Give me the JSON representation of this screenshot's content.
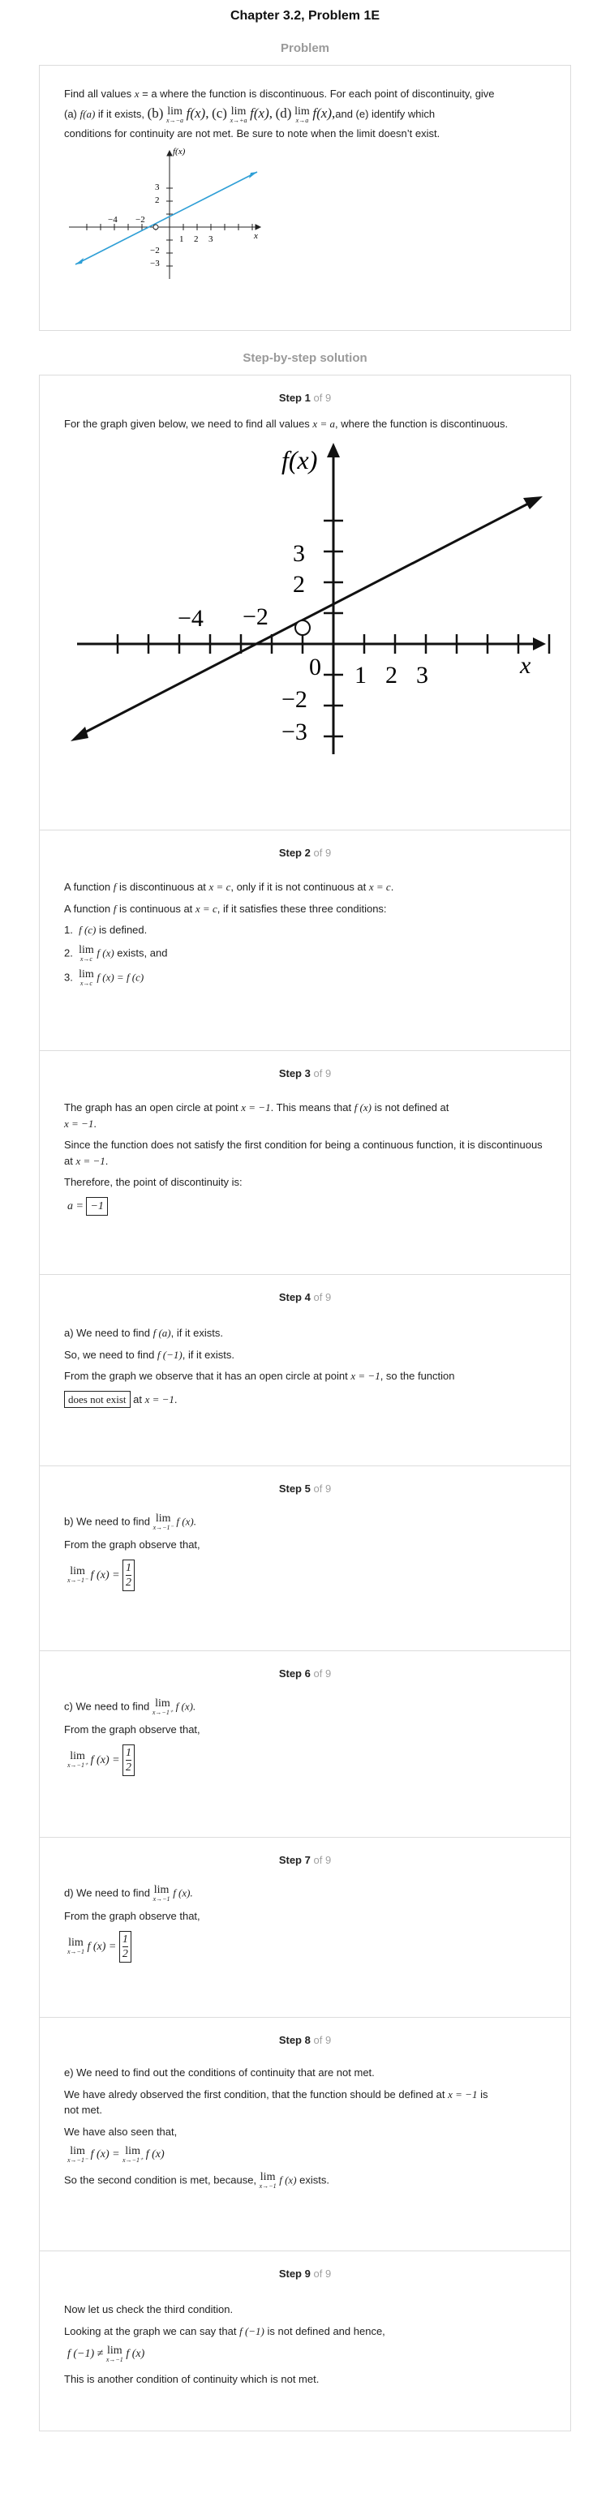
{
  "header": {
    "chapter_title": "Chapter 3.2, Problem 1E"
  },
  "problem": {
    "heading": "Problem",
    "text_a": "Find all values ",
    "var_x": "x",
    "eq_a": " = a",
    "text_b": " where the function is discontinuous. For each point of discontinuity, give",
    "part_a": "(a) ",
    "fa": "f(a)",
    "if_exists": " if it exists,",
    "part_b": "(b)",
    "part_c": "(c)",
    "part_d": "(d)",
    "lim_word": "lim",
    "sub_left": "x→−a",
    "sub_right": "x→+a",
    "sub_both": "x→a",
    "fx": "f(x)",
    "tail": "and (e) identify which",
    "text_c": "conditions for continuity are not met. Be sure to note when the limit doesn’t exist.",
    "graph": {
      "fx_label": "f(x)",
      "x_label": "x",
      "ticks_pos": [
        "1",
        "2",
        "3"
      ],
      "ticks_neg": [
        "−4",
        "−2"
      ],
      "yticks_pos": [
        "3",
        "2"
      ],
      "yticks_neg": [
        "−2",
        "−3"
      ],
      "line_color": "#2f9fd6"
    }
  },
  "solution": {
    "heading": "Step-by-step solution",
    "step_word": "Step",
    "of_word": "of 9",
    "steps": [
      {
        "num": "1",
        "text1": "For the graph given below, we need to find all values ",
        "math1": "x = a",
        "text2": ", where the function is discontinuous.",
        "graph": {
          "fx_label": "f(x)",
          "x_label": "x",
          "ticks_pos": [
            "1",
            "2",
            "3"
          ],
          "ticks_neg": [
            "−4",
            "−2"
          ],
          "origin": "0",
          "yticks_pos": [
            "3",
            "2"
          ],
          "yticks_neg": [
            "−2",
            "−3"
          ]
        }
      },
      {
        "num": "2",
        "l1a": "A function ",
        "f": "f",
        "l1b": " is discontinuous at ",
        "xc": "x = c",
        "l1c": ", only if it is not continuous at ",
        "l1d": ".",
        "l2a": "A function ",
        "l2b": " is continuous at ",
        "l2c": ", if it satisfies these three conditions:",
        "c1n": "1.",
        "c1m": "f (c)",
        "c1t": " is defined.",
        "c2n": "2.",
        "c2lim": "lim",
        "c2sub": "x→c",
        "c2m": "f (x)",
        "c2t": " exists, and",
        "c3n": "3.",
        "c3lim": "lim",
        "c3sub": "x→c",
        "c3m": "f (x) = f (c)"
      },
      {
        "num": "3",
        "l1a": "The graph has an open circle at point ",
        "l1m": "x = −1",
        "l1b": ". This means that ",
        "l1m2": "f (x)",
        "l1c": " is not defined at",
        "l1m3": "x = −1",
        "l1d": ".",
        "l2": "Since the function does not satisfy the first condition for being a continuous function, it is discontinuous at ",
        "l2m": "x = −1",
        "l2d": ".",
        "l3": "Therefore, the point of discontinuity is:",
        "ans_lhs": "a =",
        "ans": "−1"
      },
      {
        "num": "4",
        "l1a": "a) We need to find ",
        "l1m": "f (a)",
        "l1b": ", if it exists.",
        "l2a": "So, we need to find ",
        "l2m": "f (−1)",
        "l2b": ", if it exists.",
        "l3a": "From the graph we observe that it has an open circle at point ",
        "l3m": "x = −1",
        "l3b": ", so the function",
        "ans": "does not exist",
        "l4a": " at ",
        "l4m": "x = −1",
        "l4b": "."
      },
      {
        "num": "5",
        "l1a": "b) We need to find ",
        "lim": "lim",
        "sub": "x→−1⁻",
        "fx": "f (x).",
        "l2": "From the graph observe that,",
        "eq_fx": "f (x) =",
        "num_top": "1",
        "num_bot": "2"
      },
      {
        "num": "6",
        "l1a": "c) We need to find ",
        "lim": "lim",
        "sub": "x→−1⁺",
        "fx": "f (x).",
        "l2": "From the graph observe that,",
        "eq_fx": "f (x) =",
        "num_top": "1",
        "num_bot": "2"
      },
      {
        "num": "7",
        "l1a": "d) We need to find ",
        "lim": "lim",
        "sub": "x→−1",
        "fx": "f (x).",
        "l2": "From the graph observe that,",
        "eq_fx": "f (x) =",
        "num_top": "1",
        "num_bot": "2"
      },
      {
        "num": "8",
        "l1": "e) We need to find out the conditions of continuity that are not met.",
        "l2a": "We have alredy observed the first condition, that the function should be defined at ",
        "l2m": "x = −1",
        "l2b": " is",
        "l2c": "not met.",
        "l3": "We have also seen that,",
        "lim": "lim",
        "sub_l": "x→−1⁻",
        "sub_r": "x→−1⁺",
        "eq_a": "f (x) =",
        "eq_b": "f (x)",
        "l4a": "So the second condition is met, because, ",
        "sub_c": "x→−1",
        "l4m": "f (x)",
        "l4b": " exists."
      },
      {
        "num": "9",
        "l1": "Now let us check the third condition.",
        "l2a": "Looking at the graph we can say that ",
        "l2m": "f (−1)",
        "l2b": " is not defined and hence,",
        "eq_a": "f (−1) ≠",
        "lim": "lim",
        "sub": "x→−1",
        "eq_b": "f (x)",
        "l3": "This is another condition of continuity which is not met."
      }
    ]
  }
}
